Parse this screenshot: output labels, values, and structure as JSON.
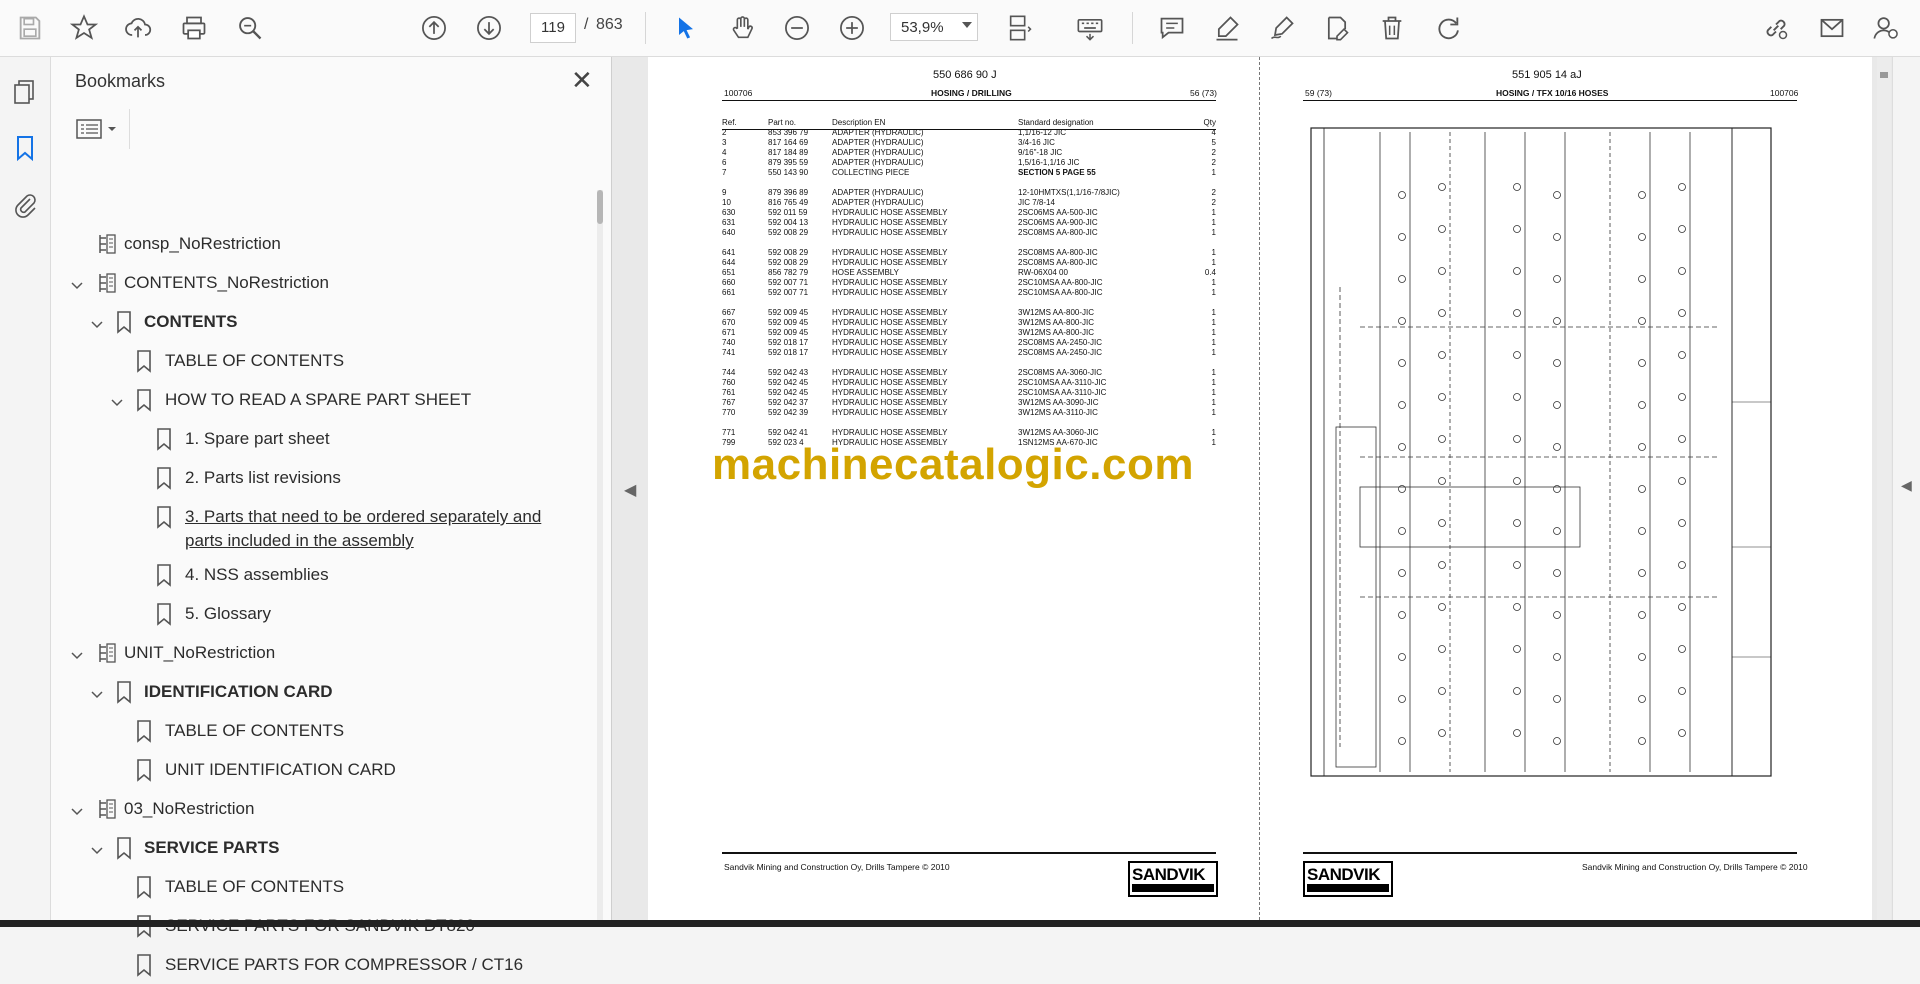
{
  "toolbar": {
    "page_current": "119",
    "page_separator": "/",
    "page_total": "863",
    "zoom": "53,9%",
    "icons": [
      "save-icon",
      "star-icon",
      "upload-icon",
      "print-icon",
      "search-icon",
      "arrow-up-icon",
      "arrow-down-icon",
      "select-cursor-icon",
      "hand-icon",
      "zoom-out-icon",
      "zoom-in-icon",
      "page-layout-icon",
      "keyboard-icon",
      "comment-icon",
      "highlight-icon",
      "sign-icon",
      "edit-pdf-icon",
      "delete-icon",
      "redo-icon",
      "share-link-icon",
      "email-icon",
      "account-icon"
    ]
  },
  "bookmarks": {
    "title": "Bookmarks",
    "items": [
      {
        "label": "consp_NoRestriction"
      },
      {
        "label": "CONTENTS_NoRestriction"
      },
      {
        "label": "CONTENTS"
      },
      {
        "label": "TABLE OF CONTENTS"
      },
      {
        "label": "HOW TO READ A SPARE PART SHEET"
      },
      {
        "label": "1. Spare part sheet"
      },
      {
        "label": "2. Parts list revisions"
      },
      {
        "label": "3. Parts that need to be ordered separately and"
      },
      {
        "label": "parts included in the assembly"
      },
      {
        "label": "4. NSS assemblies"
      },
      {
        "label": "5. Glossary"
      },
      {
        "label": "UNIT_NoRestriction"
      },
      {
        "label": "IDENTIFICATION CARD"
      },
      {
        "label": "TABLE OF CONTENTS"
      },
      {
        "label": "UNIT IDENTIFICATION CARD"
      },
      {
        "label": "03_NoRestriction"
      },
      {
        "label": "SERVICE PARTS"
      },
      {
        "label": "TABLE OF CONTENTS"
      },
      {
        "label": "SERVICE PARTS FOR SANDVIK DT820"
      },
      {
        "label": "SERVICE PARTS FOR COMPRESSOR / CT16"
      }
    ]
  },
  "left_page": {
    "doc_number": "550 686 90 J",
    "code": "100706",
    "title": "HOSING / DRILLING",
    "page_ref": "56 (73)",
    "headers": [
      "Ref.",
      "Part no.",
      "Description EN",
      "Standard designation",
      "Qty"
    ],
    "rows": [
      [
        "2",
        "853 396 79",
        "ADAPTER (HYDRAULIC)",
        "1,1/16-12 JIC",
        "4"
      ],
      [
        "3",
        "817 164 69",
        "ADAPTER (HYDRAULIC)",
        "3/4-16 JIC",
        "5"
      ],
      [
        "4",
        "817 184 89",
        "ADAPTER (HYDRAULIC)",
        "9/16\"-18 JIC",
        "2"
      ],
      [
        "6",
        "879 395 59",
        "ADAPTER (HYDRAULIC)",
        "1,5/16-1,1/16 JIC",
        "2"
      ],
      [
        "7",
        "550 143 90",
        "COLLECTING PIECE",
        "SECTION 5 PAGE 55",
        "1"
      ],
      [
        "",
        "",
        "",
        "",
        ""
      ],
      [
        "9",
        "879 396 89",
        "ADAPTER (HYDRAULIC)",
        "12-10HMTXS(1,1/16-7/8JIC)",
        "2"
      ],
      [
        "10",
        "816 765 49",
        "ADAPTER (HYDRAULIC)",
        "JIC 7/8-14",
        "2"
      ],
      [
        "630",
        "592 011 59",
        "HYDRAULIC HOSE ASSEMBLY",
        "2SC06MS AA-500-JIC",
        "1"
      ],
      [
        "631",
        "592 004 13",
        "HYDRAULIC HOSE ASSEMBLY",
        "2SC06MS AA-900-JIC",
        "1"
      ],
      [
        "640",
        "592 008 29",
        "HYDRAULIC HOSE ASSEMBLY",
        "2SC08MS AA-800-JIC",
        "1"
      ],
      [
        "",
        "",
        "",
        "",
        ""
      ],
      [
        "641",
        "592 008 29",
        "HYDRAULIC HOSE ASSEMBLY",
        "2SC08MS AA-800-JIC",
        "1"
      ],
      [
        "644",
        "592 008 29",
        "HYDRAULIC HOSE ASSEMBLY",
        "2SC08MS AA-800-JIC",
        "1"
      ],
      [
        "651",
        "856 782 79",
        "HOSE ASSEMBLY",
        "RW-06X04 00",
        "0.4"
      ],
      [
        "660",
        "592 007 71",
        "HYDRAULIC HOSE ASSEMBLY",
        "2SC10MSA AA-800-JIC",
        "1"
      ],
      [
        "661",
        "592 007 71",
        "HYDRAULIC HOSE ASSEMBLY",
        "2SC10MSA AA-800-JIC",
        "1"
      ],
      [
        "",
        "",
        "",
        "",
        ""
      ],
      [
        "667",
        "592 009 45",
        "HYDRAULIC HOSE ASSEMBLY",
        "3W12MS AA-800-JIC",
        "1"
      ],
      [
        "670",
        "592 009 45",
        "HYDRAULIC HOSE ASSEMBLY",
        "3W12MS AA-800-JIC",
        "1"
      ],
      [
        "671",
        "592 009 45",
        "HYDRAULIC HOSE ASSEMBLY",
        "3W12MS AA-800-JIC",
        "1"
      ],
      [
        "740",
        "592 018 17",
        "HYDRAULIC HOSE ASSEMBLY",
        "2SC08MS AA-2450-JIC",
        "1"
      ],
      [
        "741",
        "592 018 17",
        "HYDRAULIC HOSE ASSEMBLY",
        "2SC08MS AA-2450-JIC",
        "1"
      ],
      [
        "",
        "",
        "",
        "",
        ""
      ],
      [
        "744",
        "592 042 43",
        "HYDRAULIC HOSE ASSEMBLY",
        "2SC08MS AA-3060-JIC",
        "1"
      ],
      [
        "760",
        "592 042 45",
        "HYDRAULIC HOSE ASSEMBLY",
        "2SC10MSA AA-3110-JIC",
        "1"
      ],
      [
        "761",
        "592 042 45",
        "HYDRAULIC HOSE ASSEMBLY",
        "2SC10MSA AA-3110-JIC",
        "1"
      ],
      [
        "767",
        "592 042 37",
        "HYDRAULIC HOSE ASSEMBLY",
        "3W12MS AA-3090-JIC",
        "1"
      ],
      [
        "770",
        "592 042 39",
        "HYDRAULIC HOSE ASSEMBLY",
        "3W12MS AA-3110-JIC",
        "1"
      ],
      [
        "",
        "",
        "",
        "",
        ""
      ],
      [
        "771",
        "592 042 41",
        "HYDRAULIC HOSE ASSEMBLY",
        "3W12MS AA-3060-JIC",
        "1"
      ],
      [
        "799",
        "592 023 4",
        "HYDRAULIC HOSE ASSEMBLY",
        "1SN12MS AA-670-JIC",
        "1"
      ]
    ],
    "footer": "Sandvik Mining and Construction Oy, Drills Tampere © 2010",
    "logo": "SANDVIK"
  },
  "right_page": {
    "doc_number": "551 905 14 aJ",
    "page_ref": "59 (73)",
    "title": "HOSING / TFX 10/16 HOSES",
    "code": "100706",
    "footer": "Sandvik Mining and Construction Oy, Drills Tampere © 2010",
    "logo": "SANDVIK"
  },
  "watermark": "machinecatalogic.com"
}
